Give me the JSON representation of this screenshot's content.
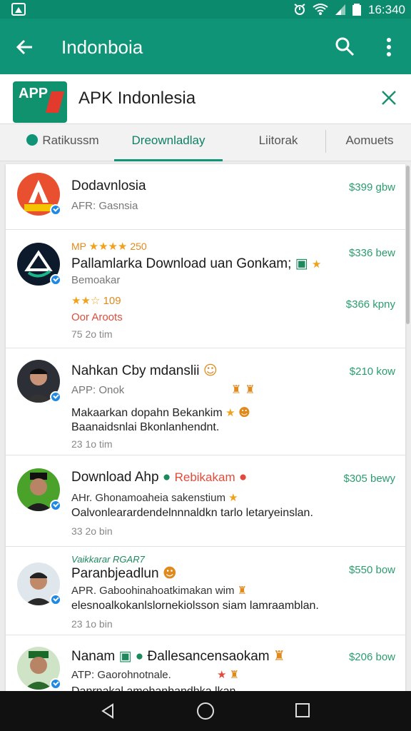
{
  "status_bar": {
    "time": "16:340"
  },
  "toolbar": {
    "title": "Indonboia"
  },
  "app": {
    "logo_text": "APP",
    "title": "APK Indonlesia"
  },
  "tabs": [
    {
      "label": "Ratikussm",
      "active": false
    },
    {
      "label": "Dreownladlay",
      "active": true
    },
    {
      "label": "Liitorak",
      "active": false
    },
    {
      "label": "Aomuets",
      "active": false
    }
  ],
  "items": [
    {
      "title": "Dodavnlosia",
      "sub": "AFR: Gasnsia",
      "price": "$399 gbw"
    },
    {
      "rating_top": "MP",
      "rating_top_count": "250",
      "title": "Pallamlarka Download uan Gonkam;",
      "sub": "Bemoakar",
      "rating_count": "109",
      "body": "Oor Aroots",
      "time": "75 2o tim",
      "price": "$336 bew",
      "price2": "$366 kpny"
    },
    {
      "title": "Nahkan Cby mdanslii",
      "sub": "APP: Onok",
      "body1": "Makaarkan dopahn Bekankim",
      "body2": "Baanaidsnlai Bkonlanhendnt.",
      "time": "23 1o tim",
      "price": "$210 kow"
    },
    {
      "title": "Download Ahp",
      "title_tag": "Rebikakam",
      "sub": "AHr. Ghonamoaheia sakenstium",
      "body": "Oalvonlearardendelnnnaldkn tarlo letaryeinslan.",
      "time": "33 2o bin",
      "price": "$305 bewy"
    },
    {
      "overline": "Vaikkarar RGAR7",
      "title": "Paranbjeadlun",
      "sub": "APR. Gaboohinahoatkimakan wim",
      "body": "elesnoalkokanlslornekiolsson siam lamraamblan.",
      "time": "23 1o bin",
      "price": "$550 bow"
    },
    {
      "title": "Nanam",
      "title_tag": "Ðallesancensaokam",
      "sub": "ATP: Gaorohnotnale.",
      "body": "Danrnakal amehanhandhka lkan",
      "price": "$206 bow"
    }
  ]
}
